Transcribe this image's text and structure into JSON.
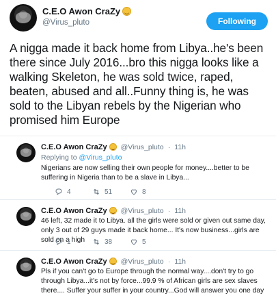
{
  "header": {
    "name": "C.E.O Awon CraZy",
    "handle": "@Virus_pluto",
    "follow_label": "Following"
  },
  "main_tweet": {
    "text": "A nigga made it back home from Libya..he's been there since July 2016...bro this nigga looks like a walking Skeleton, he was sold twice, raped, beaten, abused and all..Funny thing is, he was sold to the Libyan rebels by the Nigerian who promised him Europe"
  },
  "replies": [
    {
      "name": "C.E.O Awon CraZy",
      "handle": "@Virus_pluto",
      "time": "11h",
      "replying_prefix": "Replying to",
      "replying_to": "@Virus_pluto",
      "text": "Nigerians are now selling their own people for money....better to be suffering in Nigeria than to be a slave in Libya...",
      "reply_count": "4",
      "retweet_count": "51",
      "like_count": "8"
    },
    {
      "name": "C.E.O Awon CraZy",
      "handle": "@Virus_pluto",
      "time": "11h",
      "text": "46 left, 32 made it to Libya. all the girls were sold or given out same day, only 3 out of 29 guys made it back home... It's now business...girls are sold on a high",
      "reply_count": "1",
      "retweet_count": "38",
      "like_count": "5"
    },
    {
      "name": "C.E.O Awon CraZy",
      "handle": "@Virus_pluto",
      "time": "11h",
      "text": "Pls if you can't go to Europe through the normal way....don't try to go through Libya...it's not by force...99.9 % of African girls are sex slaves there.... Suffer your suffer in your country...God will answer you one day"
    }
  ],
  "separator": "·",
  "icons": {
    "reply": "reply-icon",
    "retweet": "retweet-icon",
    "like": "heart-icon",
    "emoji": "laughing-emoji-icon"
  },
  "colors": {
    "accent": "#1da1f2",
    "text": "#14171a",
    "muted": "#657786",
    "border": "#e6ecf0"
  }
}
